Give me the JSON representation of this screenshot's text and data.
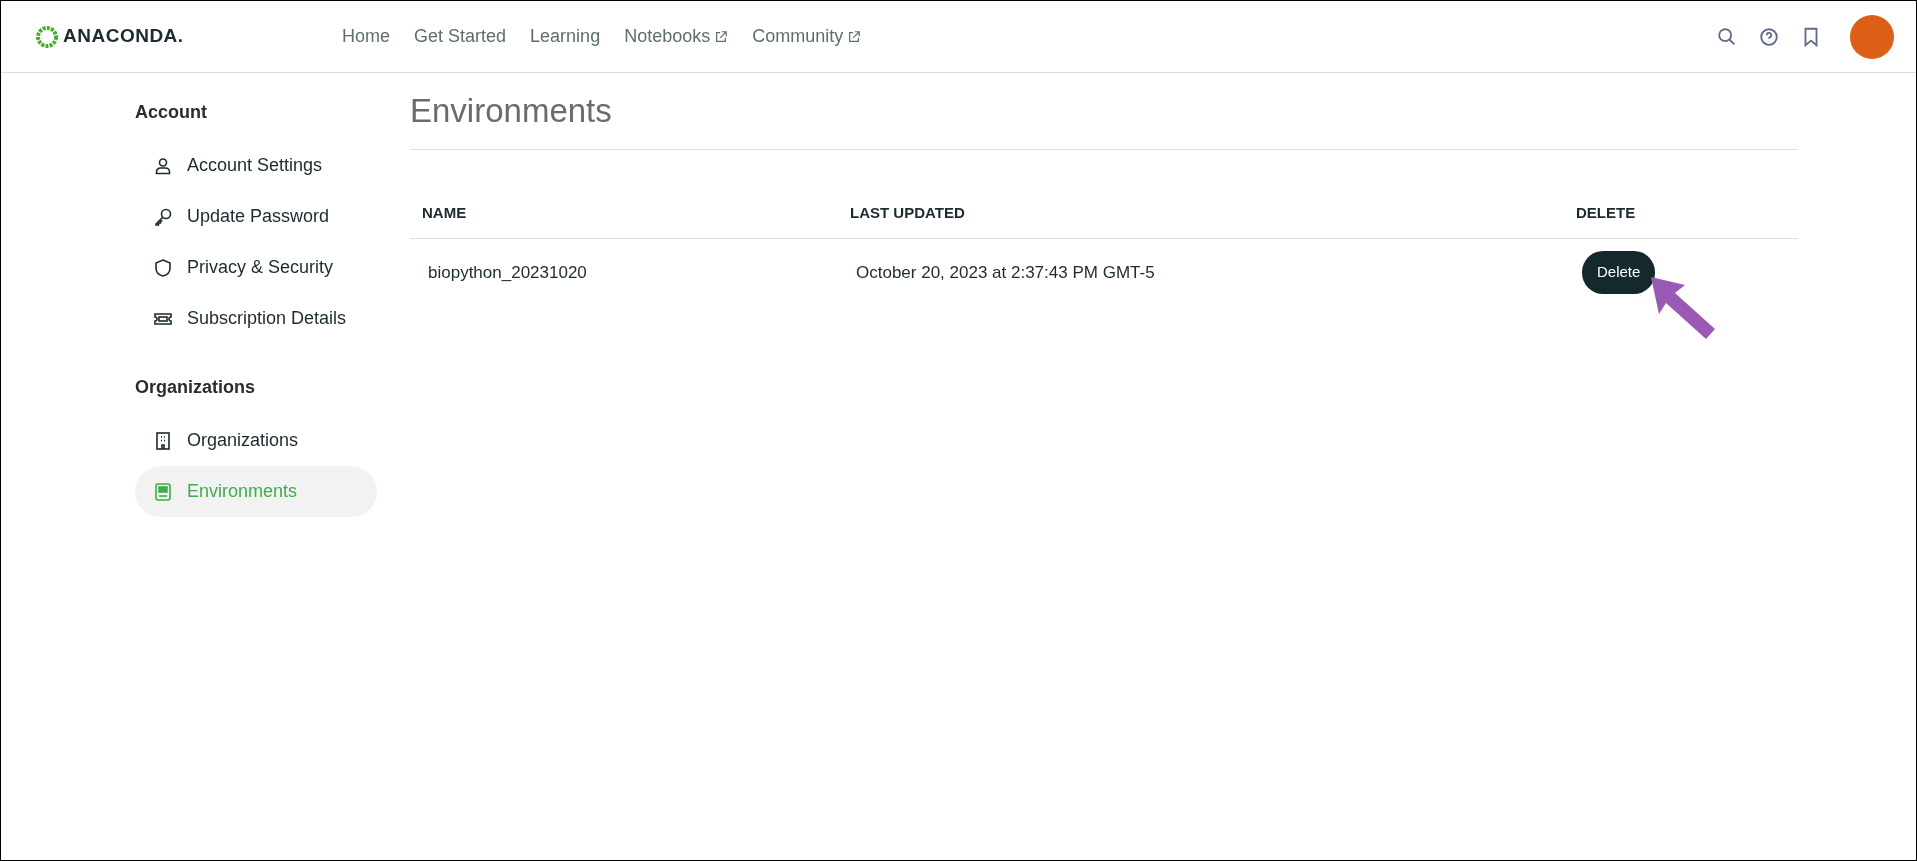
{
  "brand": {
    "name": "ANACONDA."
  },
  "nav": [
    {
      "label": "Home",
      "external": false
    },
    {
      "label": "Get Started",
      "external": false
    },
    {
      "label": "Learning",
      "external": false
    },
    {
      "label": "Notebooks",
      "external": true
    },
    {
      "label": "Community",
      "external": true
    }
  ],
  "sidebar": {
    "sections": [
      {
        "title": "Account",
        "items": [
          {
            "label": "Account Settings",
            "kind": "person",
            "selected": false
          },
          {
            "label": "Update Password",
            "kind": "key",
            "selected": false
          },
          {
            "label": "Privacy & Security",
            "kind": "shield",
            "selected": false
          },
          {
            "label": "Subscription Details",
            "kind": "ticket",
            "selected": false
          }
        ]
      },
      {
        "title": "Organizations",
        "items": [
          {
            "label": "Organizations",
            "kind": "building",
            "selected": false
          },
          {
            "label": "Environments",
            "kind": "monitor",
            "selected": true
          }
        ]
      }
    ]
  },
  "page_title": "Environments",
  "table": {
    "columns": [
      "NAME",
      "LAST UPDATED",
      "DELETE"
    ],
    "rows": [
      {
        "name": "biopython_20231020",
        "last_updated": "October 20, 2023 at 2:37:43 PM GMT-5",
        "action": "Delete"
      }
    ]
  }
}
